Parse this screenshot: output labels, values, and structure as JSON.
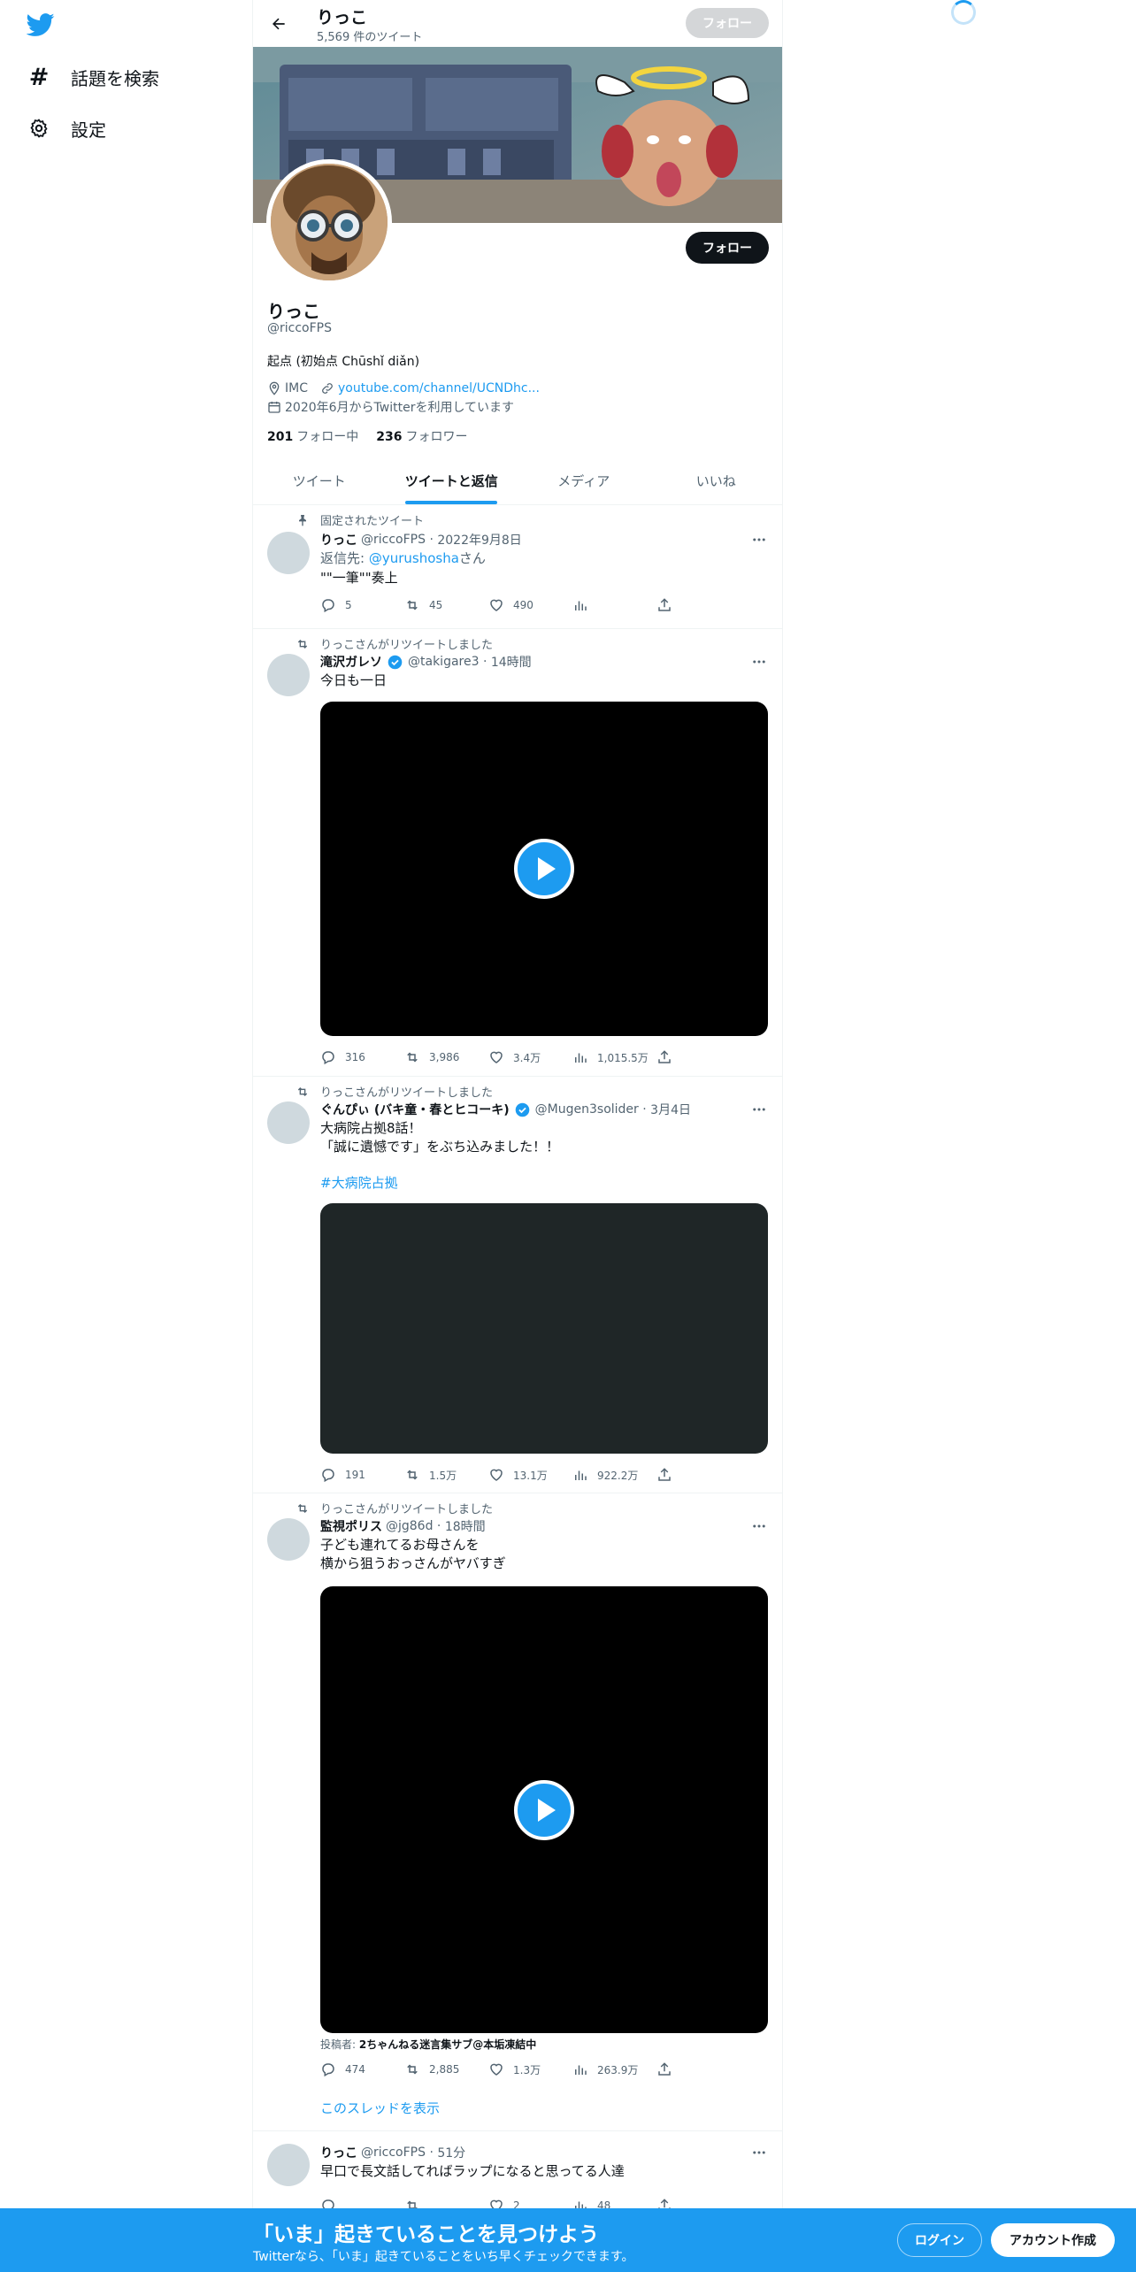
{
  "nav": {
    "logo": "twitter-bird-icon",
    "items": [
      {
        "label": "話題を検索",
        "icon": "hashtag-icon"
      },
      {
        "label": "設定",
        "icon": "gear-icon"
      }
    ]
  },
  "topbar": {
    "name": "りっこ",
    "tweet_count": "5,569 件のツイート",
    "follow_label": "フォロー"
  },
  "profile": {
    "follow_label": "フォロー",
    "name": "りっこ",
    "handle": "@riccoFPS",
    "bio": "起点 (初始点 Chūshǐ diǎn)",
    "location": "IMC",
    "url": "youtube.com/channel/UCNDhc...",
    "joined": "2020年6月からTwitterを利用しています",
    "following_count": "201",
    "following_label": "フォロー中",
    "followers_count": "236",
    "followers_label": "フォロワー"
  },
  "tabs": [
    {
      "label": "ツイート",
      "active": false
    },
    {
      "label": "ツイートと返信",
      "active": true
    },
    {
      "label": "メディア",
      "active": false
    },
    {
      "label": "いいね",
      "active": false
    }
  ],
  "tweets": [
    {
      "social": "固定されたツイート",
      "name": "りっこ",
      "handle": "@riccoFPS",
      "time": "2022年9月8日",
      "reply_prefix": "返信先: ",
      "reply_to": "@yurushosha",
      "reply_suffix": "さん",
      "text": "\"\"一筆\"\"奏上",
      "replies": "5",
      "retweets": "45",
      "likes": "490",
      "views": ""
    },
    {
      "social": "りっこさんがリツイートしました",
      "name": "滝沢ガレソ",
      "handle": "@takigare3",
      "time": "14時間",
      "text": "今日も一日",
      "replies": "316",
      "retweets": "3,986",
      "likes": "3.4万",
      "views": "1,015.5万"
    },
    {
      "social": "りっこさんがリツイートしました",
      "name": "ぐんぴぃ (バキ童・春とヒコーキ)",
      "handle": "@Mugen3solider",
      "time": "3月4日",
      "text_line1": "大病院占拠8話！",
      "text_line2": "「誠に遺憾です」をぶち込みました！！",
      "hashtag": "#大病院占拠",
      "replies": "191",
      "retweets": "1.5万",
      "likes": "13.1万",
      "views": "922.2万"
    },
    {
      "social": "りっこさんがリツイートしました",
      "name": "監視ポリス",
      "handle": "@jg86d",
      "time": "18時間",
      "text_line1": "子ども連れてるお母さんを",
      "text_line2": "横から狙うおっさんがヤバすぎ",
      "source_prefix": "投稿者: ",
      "source_name": "2ちゃんねる迷言集サブ@本垢凍結中",
      "replies": "474",
      "retweets": "2,885",
      "likes": "1.3万",
      "views": "263.9万",
      "thread_link": "このスレッドを表示"
    },
    {
      "name": "りっこ",
      "handle": "@riccoFPS",
      "time": "51分",
      "text": "早口で長文話してればラップになると思ってる人達",
      "replies": "",
      "retweets": "",
      "likes": "2",
      "views": "48"
    }
  ],
  "bottom": {
    "title": "「いま」起きていることを見つけよう",
    "subtitle": "Twitterなら、「いま」起きていることをいち早くチェックできます。",
    "login": "ログイン",
    "signup": "アカウント作成"
  },
  "colors": {
    "accent": "#1d9bf0",
    "text": "#0f1419",
    "secondary": "#536471",
    "border": "#eff3f4"
  }
}
